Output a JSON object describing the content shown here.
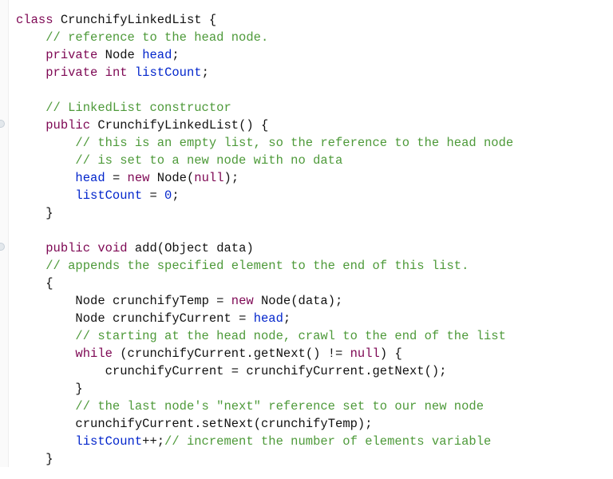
{
  "code": {
    "className": "CrunchifyLinkedList",
    "field1Comment": "// reference to the head node.",
    "kw_class": "class",
    "kw_private": "private",
    "kw_public": "public",
    "kw_new": "new",
    "kw_void": "void",
    "kw_while": "while",
    "kw_null": "null",
    "kw_int": "int",
    "typeNode": "Node",
    "typeObject": "Object",
    "fldHead": "head",
    "fldListCount": "listCount",
    "ctorComment": "// LinkedList constructor",
    "ctorName": "CrunchifyLinkedList",
    "ctorBodyC1": "// this is an empty list, so the reference to the head node",
    "ctorBodyC2": "// is set to a new node with no data",
    "zero": "0",
    "mAdd": "add",
    "pData": "data",
    "addComment": "// appends the specified element to the end of this list.",
    "vTemp": "crunchifyTemp",
    "vCurr": "crunchifyCurrent",
    "addC1": "// starting at the head node, crawl to the end of the list",
    "mGetNext": "getNext",
    "addC2": "// the last node's \"next\" reference set to our new node",
    "mSetNext": "setNext",
    "addC3": "// increment the number of elements variable"
  }
}
